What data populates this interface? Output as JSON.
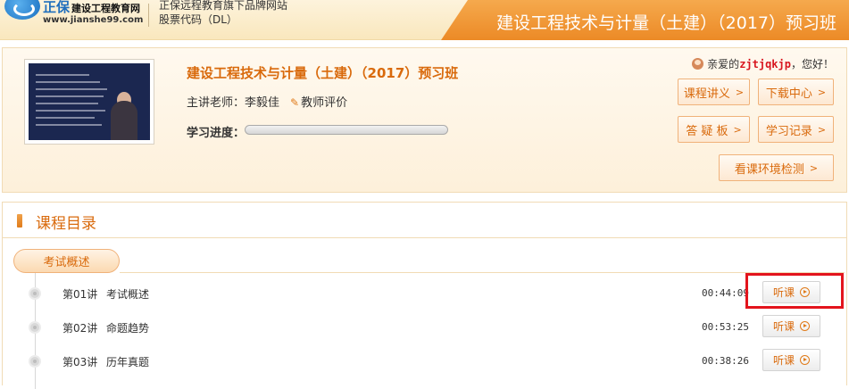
{
  "header": {
    "brand": "正保",
    "brand_sub": "建设工程教育网",
    "url": "www.jianshe99.com",
    "slogan": "正保远程教育旗下品牌网站",
    "stock": "股票代码（DL）",
    "banner_title": "建设工程技术与计量（土建）（2017）预习班"
  },
  "course": {
    "title": "建设工程技术与计量（土建）（2017）预习班",
    "teacher_label": "主讲老师：李毅佳",
    "eval_label": "教师评价",
    "progress_label": "学习进度：",
    "progress_fraction": 0
  },
  "user": {
    "greeting_prefix": "亲爱的",
    "username": "zjtjqkjp",
    "greeting_suffix": "，您好！"
  },
  "buttons": {
    "lecture": "课程讲义",
    "download": "下载中心",
    "qa": "答 疑 板",
    "record": "学习记录",
    "env_check": "看课环境检测"
  },
  "directory": {
    "title": "课程目录",
    "chapter": "考试概述",
    "lessons": [
      {
        "num": "第01讲",
        "name": "考试概述",
        "duration": "00:44:09",
        "action": "听课"
      },
      {
        "num": "第02讲",
        "name": "命题趋势",
        "duration": "00:53:25",
        "action": "听课"
      },
      {
        "num": "第03讲",
        "name": "历年真题",
        "duration": "00:38:26",
        "action": "听课"
      }
    ]
  },
  "colors": {
    "accent": "#ec8a26",
    "accent_text": "#d96a0c",
    "highlight": "#e3141c",
    "username": "#d8161f"
  }
}
